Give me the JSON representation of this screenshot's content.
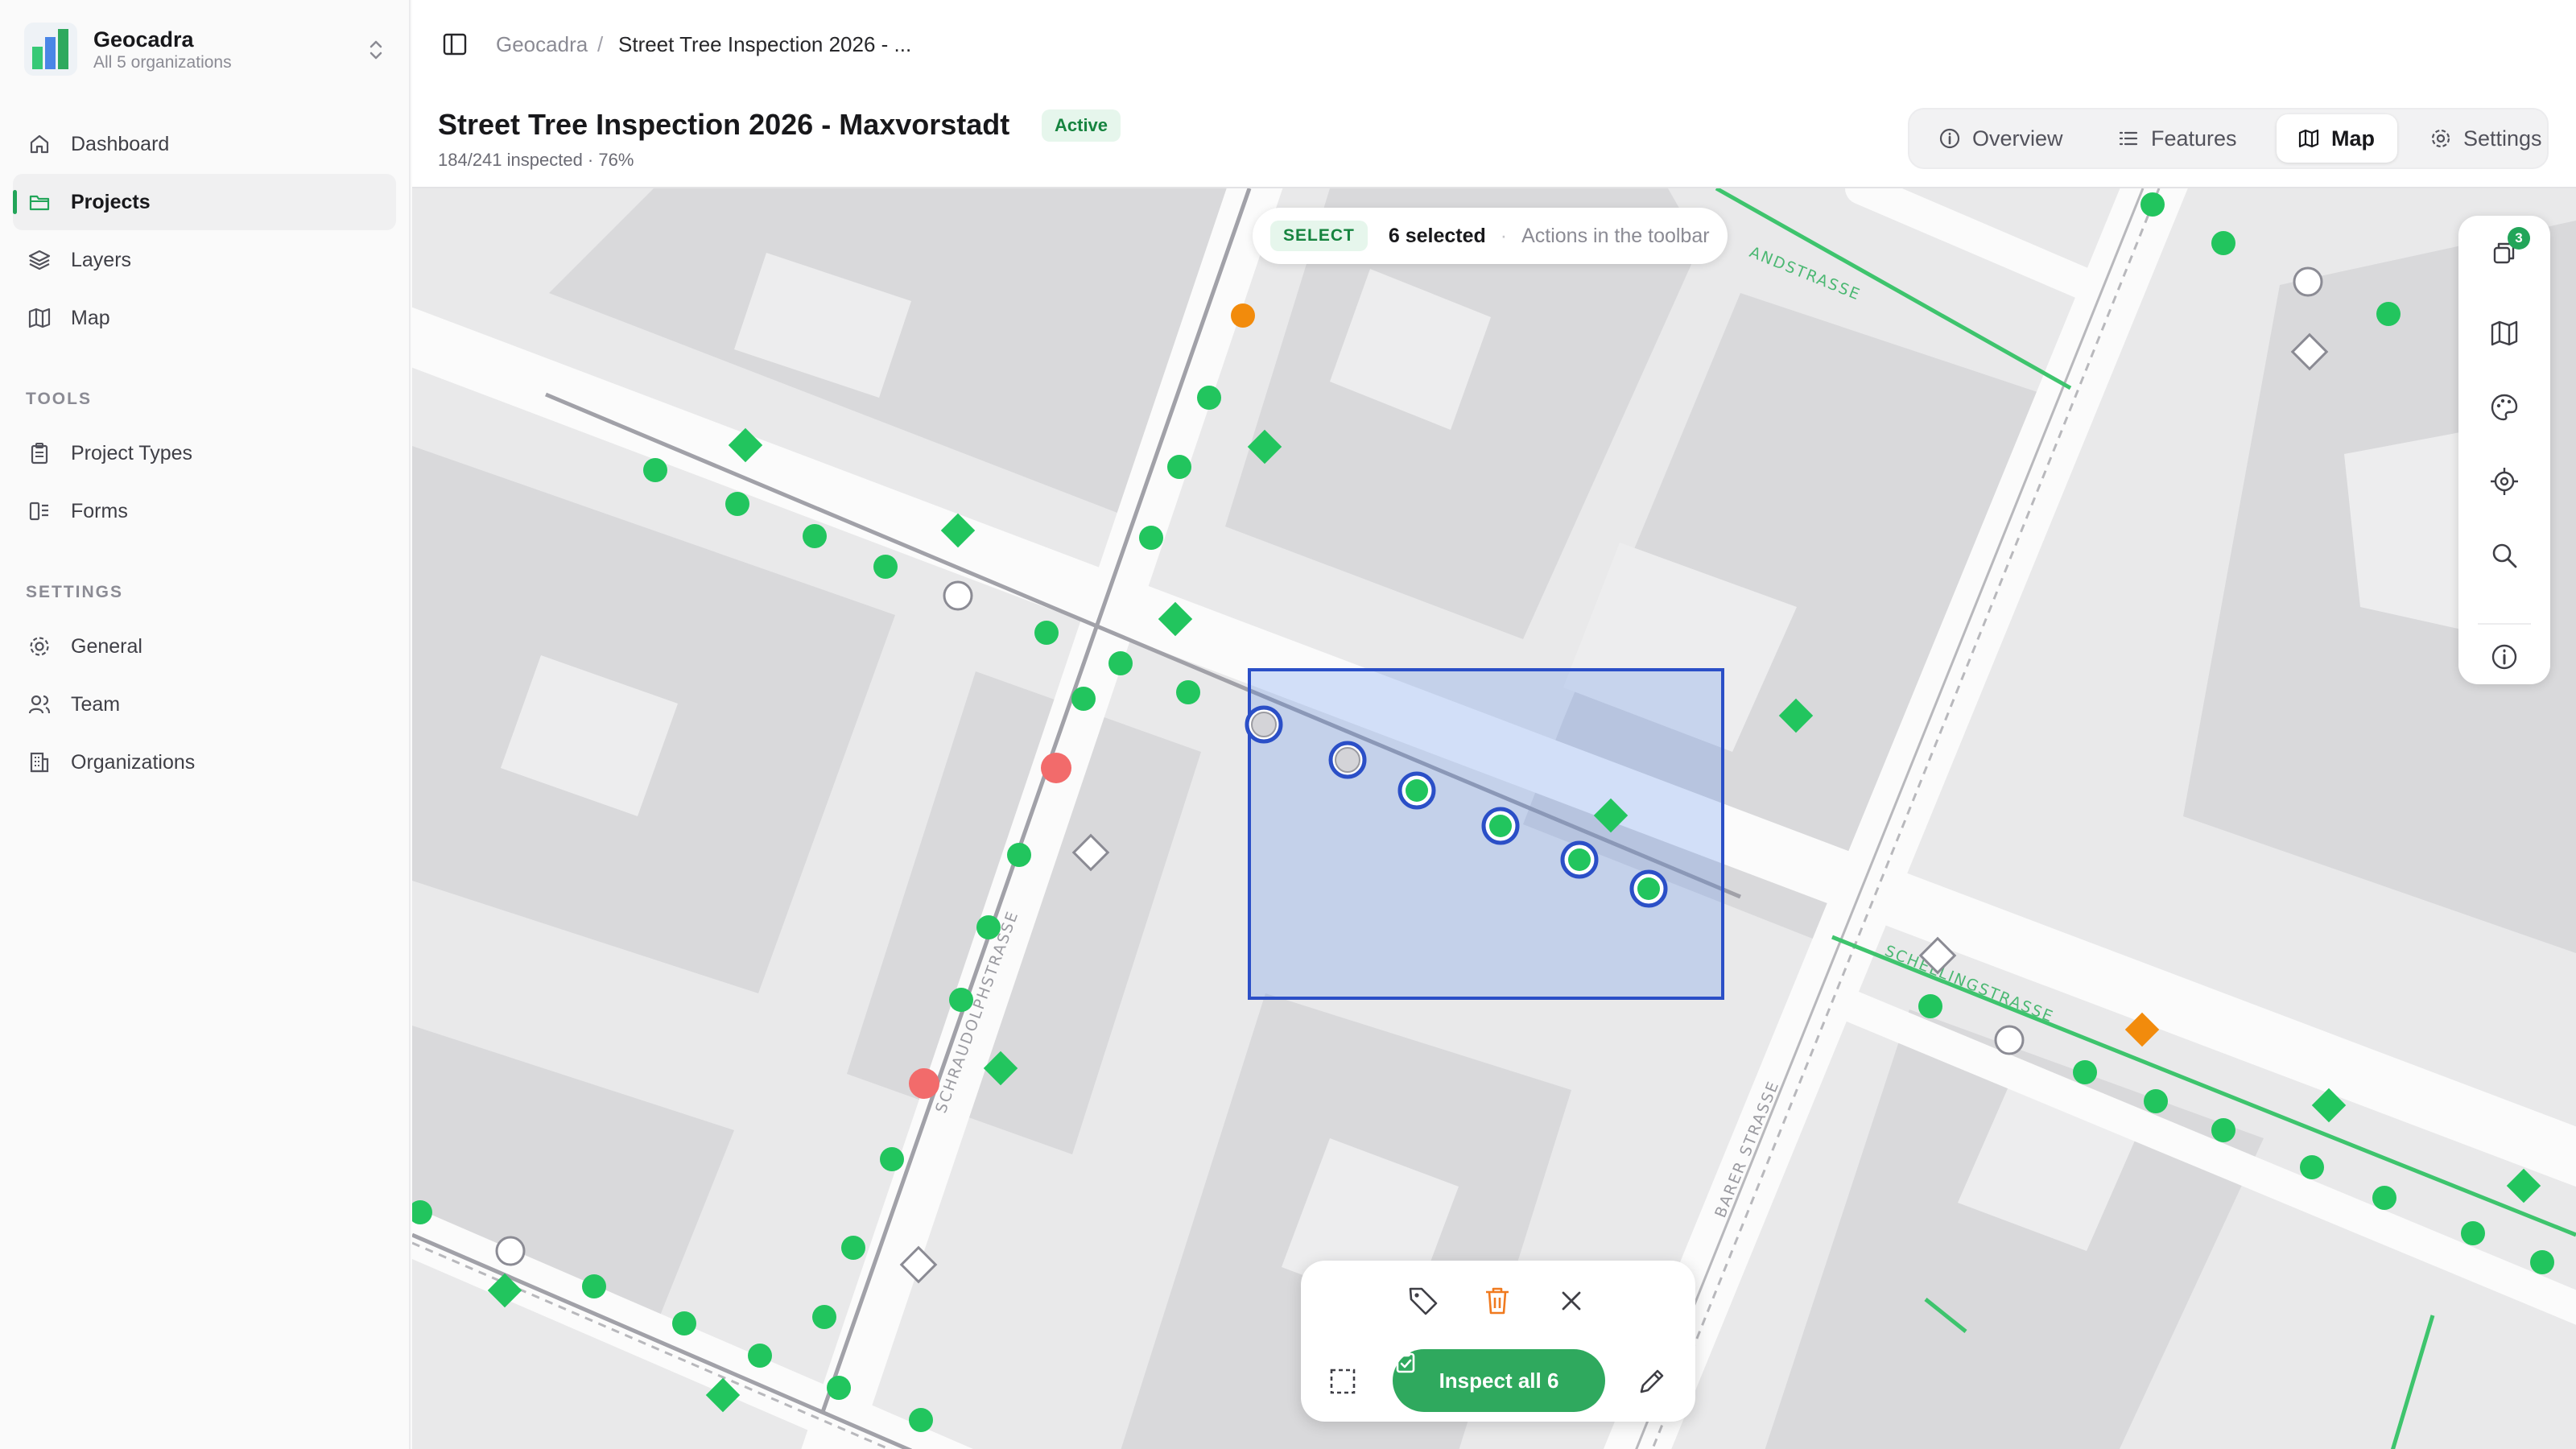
{
  "app": {
    "name": "Geocadra",
    "subtitle": "All 5 organizations"
  },
  "sidebar": {
    "items": [
      {
        "label": "Dashboard",
        "icon": "home-icon"
      },
      {
        "label": "Projects",
        "icon": "folder-icon",
        "active": true
      },
      {
        "label": "Layers",
        "icon": "layers-icon"
      },
      {
        "label": "Map",
        "icon": "map-icon"
      }
    ],
    "tools_label": "TOOLS",
    "tools": [
      {
        "label": "Project Types",
        "icon": "clipboard-icon"
      },
      {
        "label": "Forms",
        "icon": "form-icon"
      }
    ],
    "settings_label": "SETTINGS",
    "settings": [
      {
        "label": "General",
        "icon": "gear-icon"
      },
      {
        "label": "Team",
        "icon": "users-icon"
      },
      {
        "label": "Organizations",
        "icon": "building-icon"
      }
    ]
  },
  "breadcrumb": {
    "root": "Geocadra",
    "separator": "/",
    "current": "Street Tree Inspection 2026 - ..."
  },
  "project": {
    "title": "Street Tree Inspection 2026 - Maxvorstadt",
    "status": "Active",
    "progress_text": "184/241 inspected · 76%",
    "inspected": 184,
    "total": 241
  },
  "tabs": [
    {
      "label": "Overview",
      "icon": "info-icon"
    },
    {
      "label": "Features",
      "icon": "list-icon"
    },
    {
      "label": "Map",
      "icon": "map-icon",
      "active": true
    },
    {
      "label": "Settings",
      "icon": "gear-icon"
    }
  ],
  "selection": {
    "tag": "SELECT",
    "count_text": "6 selected",
    "separator": "·",
    "hint": "Actions in the toolbar"
  },
  "map_tools": {
    "layers_badge": "3"
  },
  "map": {
    "street_labels": {
      "schraudolph": "SCHRAUDOLPHSTRASSE",
      "barer": "BARER STRASSE",
      "schelling": "SCHELLINGSTRASSE",
      "top": "ANDSTRASSE"
    }
  },
  "bottom_toolbar": {
    "inspect_label": "Inspect all 6"
  },
  "colors": {
    "accent": "#22a559",
    "inspected": "#22c55e",
    "attention": "#f28b0c",
    "critical": "#f26b6b",
    "selection": "#2b4fc7"
  }
}
